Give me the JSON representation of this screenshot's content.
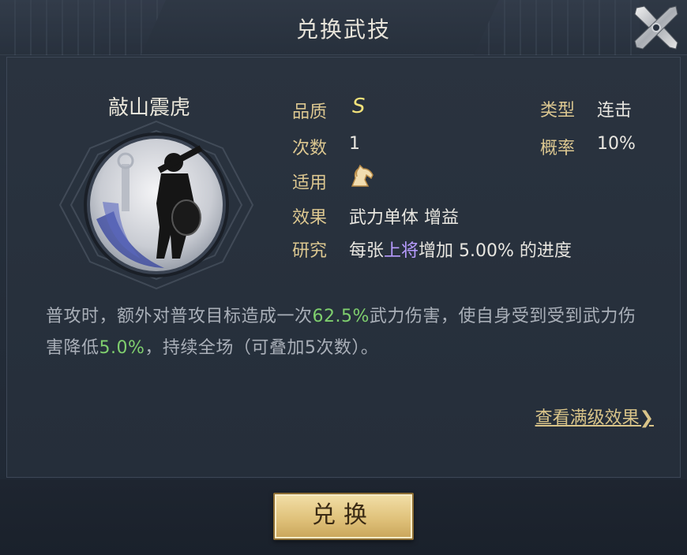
{
  "header": {
    "title": "兑换武技"
  },
  "skill": {
    "name": "敲山震虎",
    "attributes": {
      "quality_label": "品质",
      "quality_value": "S",
      "count_label": "次数",
      "count_value": "1",
      "applies_label": "适用",
      "applies_icon": "horse-icon",
      "effect_label": "效果",
      "effect_value": "武力单体 增益",
      "research_label": "研究",
      "research_prefix": "每张",
      "research_highlight": "上将",
      "research_suffix": "增加 5.00% 的进度",
      "type_label": "类型",
      "type_value": "连击",
      "chance_label": "概率",
      "chance_value": "10%"
    },
    "description": {
      "part1": "普攻时，额外对普攻目标造成一次",
      "value1": "62.5%",
      "part2": "武力伤害，使自身受到受到武力伤害降低",
      "value2": "5.0%",
      "part3": "，持续全场（可叠加5次数）。"
    }
  },
  "links": {
    "full_effect": "查看满级效果❯"
  },
  "buttons": {
    "exchange": "兑换"
  },
  "colors": {
    "gold": "#dcc790",
    "highlight_purple": "#b89cff",
    "highlight_green": "#7fcf6e"
  }
}
